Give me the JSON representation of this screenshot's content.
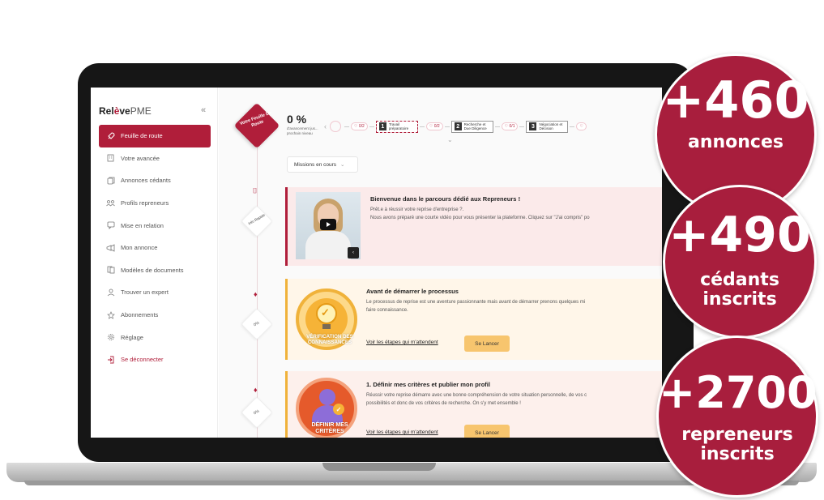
{
  "logo": {
    "prefix": "Rel",
    "accent": "è",
    "suffix": "ve",
    "product": "PME"
  },
  "sidebar": {
    "collapse_icon": "double-chevron-left-icon",
    "items": [
      {
        "label": "Feuille de route",
        "icon": "rocket-icon"
      },
      {
        "label": "Votre avancée",
        "icon": "building-icon"
      },
      {
        "label": "Annonces cédants",
        "icon": "copy-icon"
      },
      {
        "label": "Profils repreneurs",
        "icon": "users-icon"
      },
      {
        "label": "Mise en relation",
        "icon": "chat-icon"
      },
      {
        "label": "Mon annonce",
        "icon": "megaphone-icon"
      },
      {
        "label": "Modèles de documents",
        "icon": "documents-icon"
      },
      {
        "label": "Trouver un expert",
        "icon": "expert-icon"
      },
      {
        "label": "Abonnements",
        "icon": "star-icon"
      },
      {
        "label": "Réglage",
        "icon": "gear-icon"
      },
      {
        "label": "Se déconnecter",
        "icon": "logout-icon"
      }
    ]
  },
  "roadmap": {
    "label": "Votre Feuille De Route"
  },
  "progress": {
    "percent": "0 %",
    "sub1": "d'avancement jus...",
    "sub2": "prochain niveau"
  },
  "stepper": {
    "pills": [
      "0/2",
      "0/2",
      "0/1"
    ],
    "steps": [
      {
        "num": "1",
        "text": "Travail préparatoire"
      },
      {
        "num": "2",
        "text": "Recherche et Due Diligence"
      },
      {
        "num": "3",
        "text": "Négociation et Décision"
      }
    ]
  },
  "missions": {
    "label": "Missions en cours"
  },
  "timeline": {
    "info_label": "Info Rapide",
    "pct1": "0%",
    "pct2": "0%"
  },
  "welcome": {
    "title": "Bienvenue dans le parcours dédié aux Repreneurs !",
    "line1": "Prêt.e à réussir votre reprise d'entreprise ?.",
    "line2": "Nous avons préparé une courte vidéo pour vous présenter la plateforme. Cliquez sur \"J'ai compris\" po"
  },
  "start": {
    "title": "Avant de démarrer le processus",
    "line1": "Le processus de reprise est une aventure passionnante mais avant de démarrer prenons quelques mi",
    "line2": "faire connaissance.",
    "link": "Voir les étapes qui m'attendent",
    "button": "Se Lancer",
    "badge_label_1": "VÉRIFICATION DES",
    "badge_label_2": "CONNAISSANCES"
  },
  "criteria": {
    "title": "1. Définir mes critères et publier mon profil",
    "line1": "Réussir votre reprise démarre avec une bonne compréhension de votre situation personnelle, de vos c",
    "line2": "possibilités et donc de vos critères de recherche. On s'y met ensemble !",
    "link": "Voir les étapes qui m'attendent",
    "button": "Se Lancer",
    "badge_label_1": "DÉFINIR MES",
    "badge_label_2": "CRITÈRES"
  },
  "stats": [
    {
      "number": "+460",
      "label1": "annonces",
      "label2": ""
    },
    {
      "number": "+490",
      "label1": "cédants",
      "label2": "inscrits"
    },
    {
      "number": "+2700",
      "label1": "repreneurs",
      "label2": "inscrits"
    }
  ],
  "colors": {
    "brand": "#b01e3a",
    "stat_bg": "#a81e3d",
    "button": "#f7c56e"
  }
}
